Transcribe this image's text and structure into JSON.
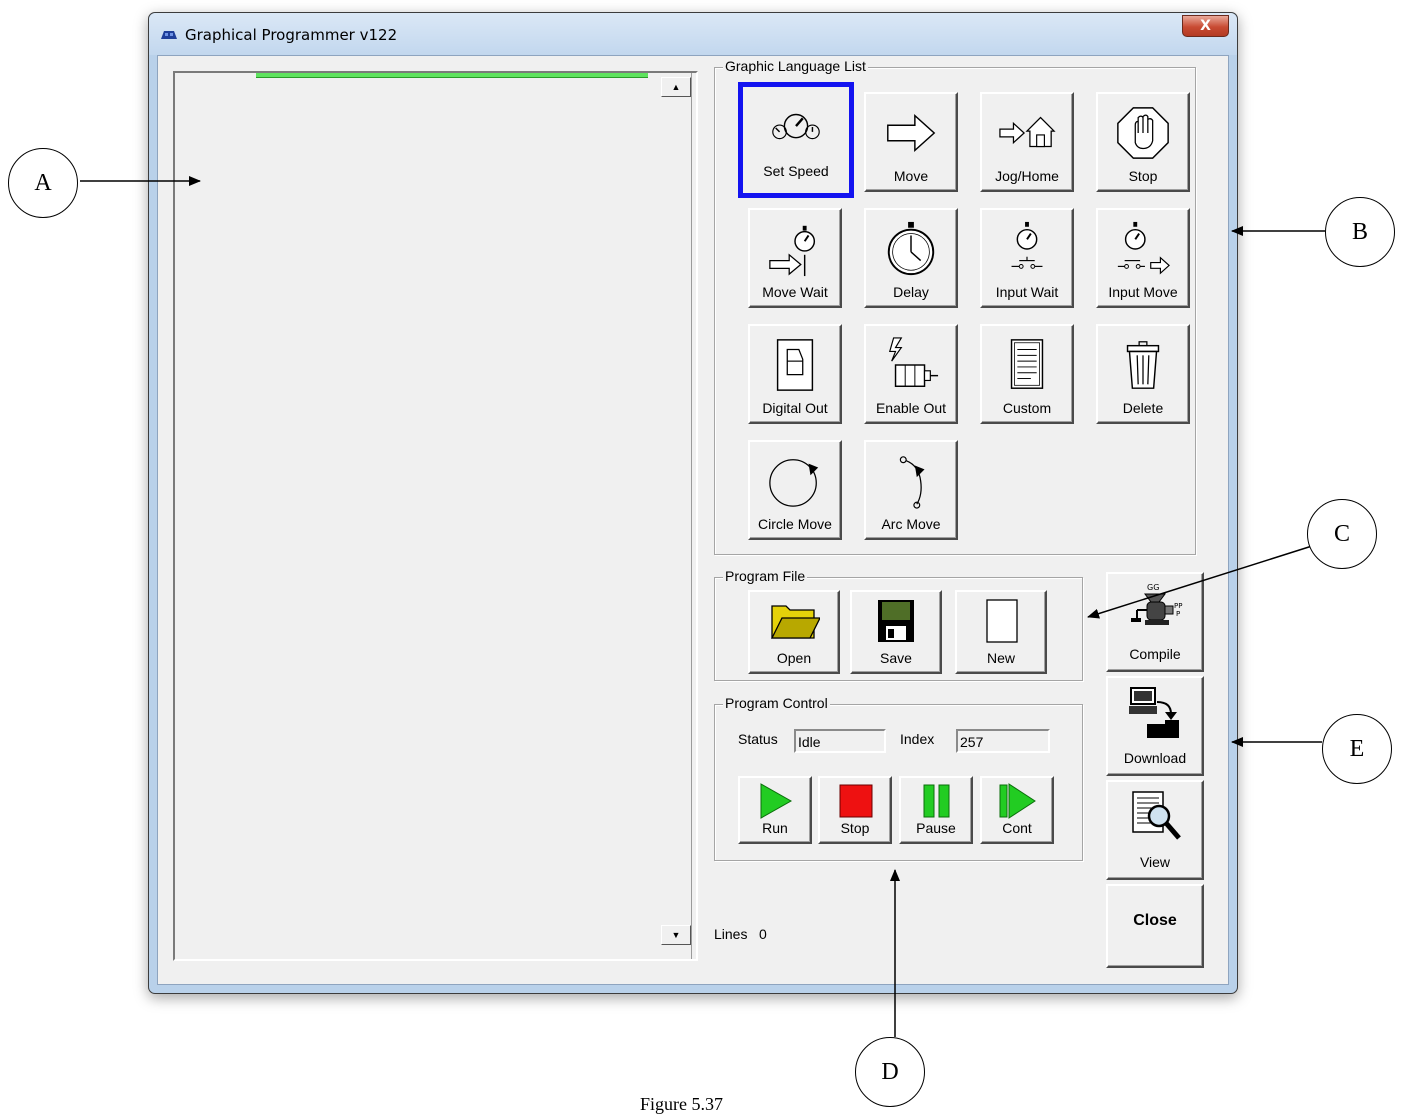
{
  "window": {
    "title": "Graphical Programmer v122",
    "close_glyph": "X"
  },
  "program_list": {
    "scroll_up_glyph": "▲",
    "scroll_down_glyph": "▼"
  },
  "graphic_language_list": {
    "title": "Graphic Language List",
    "buttons": [
      {
        "label": "Set Speed",
        "icon": "gauges-icon",
        "selected": true
      },
      {
        "label": "Move",
        "icon": "arrow-right-icon"
      },
      {
        "label": "Jog/Home",
        "icon": "arrow-house-icon"
      },
      {
        "label": "Stop",
        "icon": "stop-hand-icon"
      },
      {
        "label": "Move Wait",
        "icon": "stopwatch-arrow-icon"
      },
      {
        "label": "Delay",
        "icon": "stopwatch-icon"
      },
      {
        "label": "Input Wait",
        "icon": "stopwatch-switch-icon"
      },
      {
        "label": "Input Move",
        "icon": "stopwatch-switch-arrow-icon"
      },
      {
        "label": "Digital Out",
        "icon": "toggle-switch-icon"
      },
      {
        "label": "Enable Out",
        "icon": "lightning-motor-icon"
      },
      {
        "label": "Custom",
        "icon": "document-icon"
      },
      {
        "label": "Delete",
        "icon": "trash-can-icon"
      },
      {
        "label": "Circle Move",
        "icon": "circle-arrow-icon"
      },
      {
        "label": "Arc Move",
        "icon": "arc-arrow-icon"
      }
    ]
  },
  "program_file": {
    "title": "Program File",
    "open_label": "Open",
    "save_label": "Save",
    "new_label": "New"
  },
  "program_control": {
    "title": "Program Control",
    "status_label": "Status",
    "status_value": "Idle",
    "index_label": "Index",
    "index_value": "257",
    "run_label": "Run",
    "stop_label": "Stop",
    "pause_label": "Pause",
    "cont_label": "Cont"
  },
  "side_buttons": {
    "compile_label": "Compile",
    "download_label": "Download",
    "view_label": "View",
    "close_label": "Close"
  },
  "lines": {
    "label": "Lines",
    "value": "0"
  },
  "callouts": {
    "a": "A",
    "b": "B",
    "c": "C",
    "d": "D",
    "e": "E"
  },
  "caption": "Figure 5.37",
  "colors": {
    "selection_border": "#1313f0",
    "progress_green": "#5ee35e",
    "run_green": "#22cc22",
    "stop_red": "#ee1111",
    "title_close_red": "#c84b33"
  }
}
